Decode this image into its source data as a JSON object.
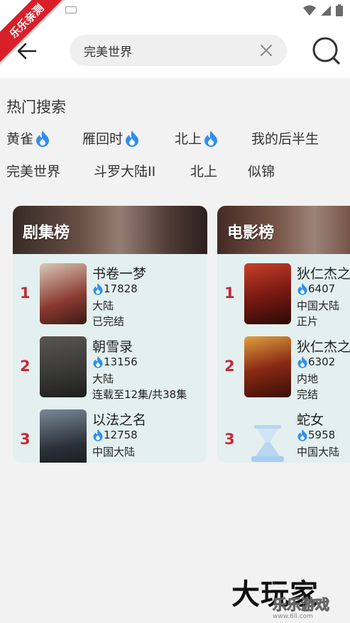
{
  "ribbon": {
    "text": "乐乐亲测"
  },
  "search": {
    "value": "完美世界",
    "placeholder": "完美世界"
  },
  "hot_search": {
    "title": "热门搜索",
    "row1": [
      {
        "label": "黄雀",
        "hot": true
      },
      {
        "label": "雁回时",
        "hot": true
      },
      {
        "label": "北上",
        "hot": true
      },
      {
        "label": "我的后半生",
        "hot": false
      }
    ],
    "row2": [
      {
        "label": "完美世界",
        "hot": false
      },
      {
        "label": "斗罗大陆II",
        "hot": false
      },
      {
        "label": "北上",
        "hot": false
      },
      {
        "label": "似锦",
        "hot": false
      }
    ]
  },
  "rankings": [
    {
      "title": "剧集榜",
      "items": [
        {
          "rank": "1",
          "name": "书卷一梦",
          "heat": "17828",
          "region": "大陆",
          "status": "已完结",
          "poster_color": "#8a3a30"
        },
        {
          "rank": "2",
          "name": "朝雪录",
          "heat": "13156",
          "region": "大陆",
          "status": "连载至12集/共38集",
          "poster_color": "#3a3a38"
        },
        {
          "rank": "3",
          "name": "以法之名",
          "heat": "12758",
          "region": "中国大陆",
          "status": "",
          "poster_color": "#2a3038"
        }
      ]
    },
    {
      "title": "电影榜",
      "items": [
        {
          "rank": "1",
          "name": "狄仁杰之",
          "heat": "6407",
          "region": "中国大陆",
          "status": "正片",
          "poster_color": "#7a1a12"
        },
        {
          "rank": "2",
          "name": "狄仁杰之",
          "heat": "6302",
          "region": "内地",
          "status": "完结",
          "poster_color": "#8a2a14"
        },
        {
          "rank": "3",
          "name": "蛇女",
          "heat": "5958",
          "region": "中国大陆",
          "status": "",
          "poster_color": "#cfe4f6"
        }
      ]
    }
  ],
  "watermark": {
    "main": "大玩家",
    "sub": "乐乐游戏",
    "url": "www.6ll.com"
  },
  "colors": {
    "accent_blue": "#2f8ff0",
    "rank_red": "#c8283a",
    "ribbon_red": "#d8202a"
  }
}
